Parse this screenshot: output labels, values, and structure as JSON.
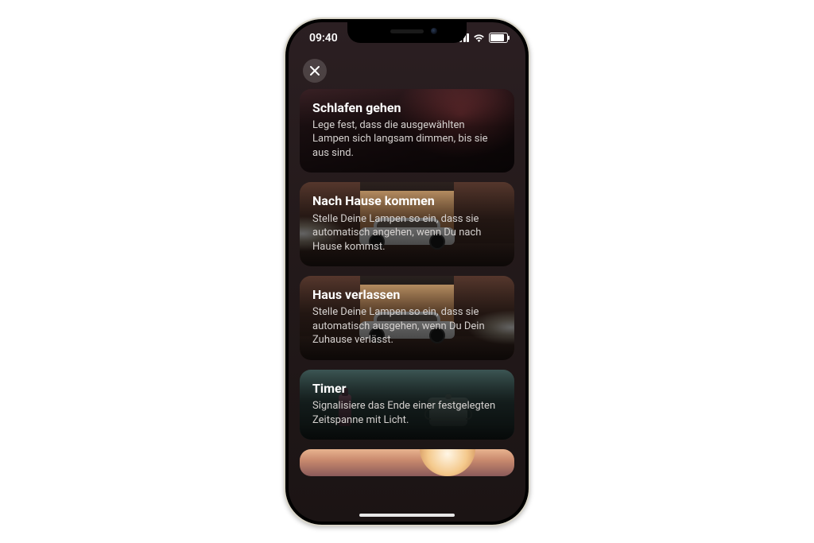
{
  "statusbar": {
    "time": "09:40"
  },
  "cards": [
    {
      "title": "Schlafen gehen",
      "desc": "Lege fest, dass die ausgewählten Lampen sich langsam dimmen, bis sie aus sind."
    },
    {
      "title": "Nach Hause kommen",
      "desc": "Stelle Deine Lampen so ein, dass sie automatisch angehen, wenn Du nach Hause kommst."
    },
    {
      "title": "Haus verlassen",
      "desc": "Stelle Deine Lampen so ein, dass sie automatisch ausgehen, wenn Du Dein Zuhause verlässt."
    },
    {
      "title": "Timer",
      "desc": "Signalisiere das Ende einer festgelegten Zeitspanne mit Licht."
    }
  ]
}
